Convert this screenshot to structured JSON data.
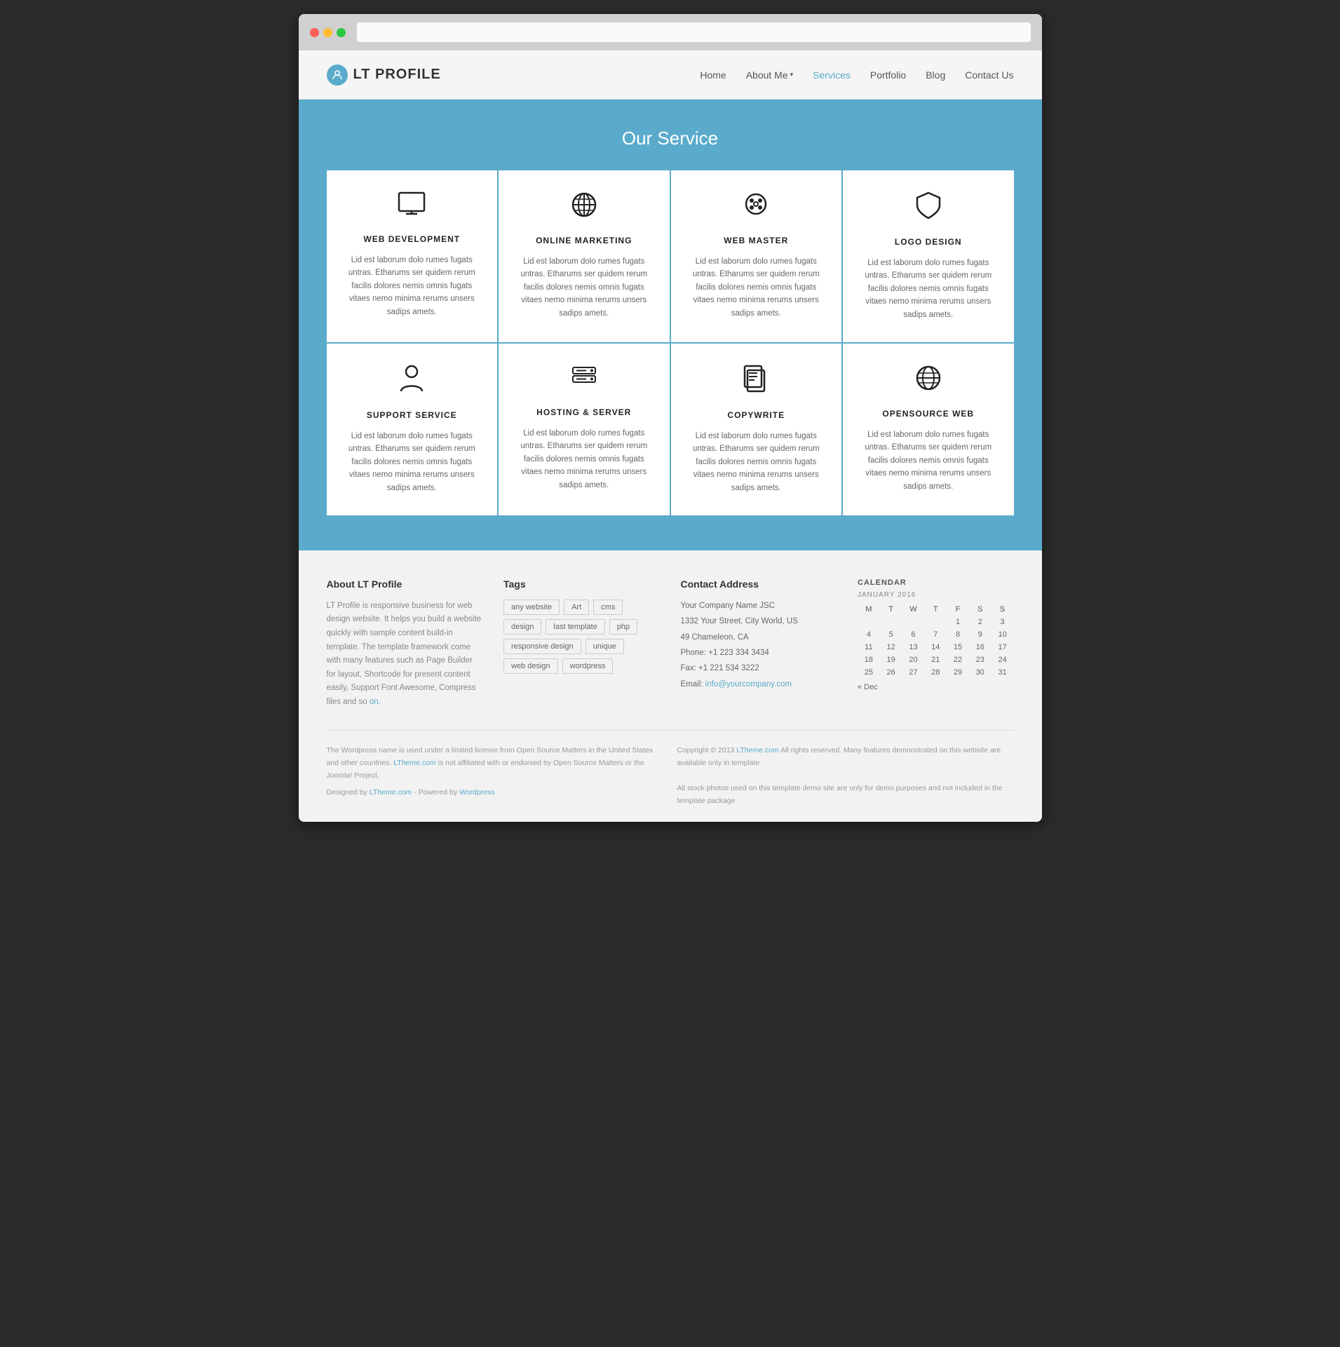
{
  "browser": {
    "dots": [
      "red",
      "yellow",
      "green"
    ]
  },
  "header": {
    "logo_text": "LT PROFILE",
    "nav_items": [
      {
        "label": "Home",
        "active": false
      },
      {
        "label": "About Me",
        "dropdown": true,
        "active": false
      },
      {
        "label": "Services",
        "active": true
      },
      {
        "label": "Portfolio",
        "active": false
      },
      {
        "label": "Blog",
        "active": false
      },
      {
        "label": "Contact Us",
        "active": false
      }
    ]
  },
  "services": {
    "section_title": "Our Service",
    "cards": [
      {
        "name": "WEB DEVELOPMENT",
        "icon": "🖥",
        "desc": "Lid est laborum dolo rumes fugats untras. Etharums ser quidem rerum facilis dolores nemis omnis fugats vitaes nemo minima rerums unsers sadips amets."
      },
      {
        "name": "ONLINE MARKETING",
        "icon": "⊕",
        "desc": "Lid est laborum dolo rumes fugats untras. Etharums ser quidem rerum facilis dolores nemis omnis fugats vitaes nemo minima rerums unsers sadips amets."
      },
      {
        "name": "WEB MASTER",
        "icon": "🎨",
        "desc": "Lid est laborum dolo rumes fugats untras. Etharums ser quidem rerum facilis dolores nemis omnis fugats vitaes nemo minima rerums unsers sadips amets."
      },
      {
        "name": "LOGO DESIGN",
        "icon": "🛡",
        "desc": "Lid est laborum dolo rumes fugats untras. Etharums ser quidem rerum facilis dolores nemis omnis fugats vitaes nemo minima rerums unsers sadips amets."
      },
      {
        "name": "SUPPORT SERVICE",
        "icon": "👤",
        "desc": "Lid est laborum dolo rumes fugats untras. Etharums ser quidem rerum facilis dolores nemis omnis fugats vitaes nemo minima rerums unsers sadips amets."
      },
      {
        "name": "HOSTING & SERVER",
        "icon": "≡",
        "desc": "Lid est laborum dolo rumes fugats untras. Etharums ser quidem rerum facilis dolores nemis omnis fugats vitaes nemo minima rerums unsers sadips amets."
      },
      {
        "name": "COPYWRITE",
        "icon": "📋",
        "desc": "Lid est laborum dolo rumes fugats untras. Etharums ser quidem rerum facilis dolores nemis omnis fugats vitaes nemo minima rerums unsers sadips amets."
      },
      {
        "name": "OPENSOURCE WEB",
        "icon": "🌐",
        "desc": "Lid est laborum dolo rumes fugats untras. Etharums ser quidem rerum facilis dolores nemis omnis fugats vitaes nemo minima rerums unsers sadips amets."
      }
    ]
  },
  "footer": {
    "about_title": "About LT Profile",
    "about_text": "LT Profile is responsive business for web design website. It helps you build a website quickly with sample content build-in template. The template framework come with many features such as Page Builder for layout, Shortcode for present content easily, Support Font Awesome, Compress files and so",
    "about_link_text": "on.",
    "tags_title": "Tags",
    "tags": [
      "any website",
      "Art",
      "cms",
      "design",
      "last template",
      "php",
      "responsive design",
      "unique",
      "web design",
      "wordpress"
    ],
    "contact_title": "Contact Address",
    "contact_company": "Your Company Name JSC",
    "contact_address1": "1332 Your Street, City World, US",
    "contact_address2": "49 Chameleon, CA",
    "contact_phone": "Phone: +1 223 334 3434",
    "contact_fax": "Fax: +1 221 534 3222",
    "contact_email_label": "Email:",
    "contact_email": "info@yourcompany.com",
    "calendar_title": "CALENDAR",
    "calendar_month": "JANUARY 2016",
    "calendar_days_header": [
      "M",
      "T",
      "W",
      "T",
      "F",
      "S",
      "S"
    ],
    "calendar_rows": [
      [
        "",
        "",
        "",
        "",
        "1",
        "2",
        "3"
      ],
      [
        "4",
        "5",
        "6",
        "7",
        "8",
        "9",
        "10"
      ],
      [
        "11",
        "12",
        "13",
        "14",
        "15",
        "16",
        "17"
      ],
      [
        "18",
        "19",
        "20",
        "21",
        "22",
        "23",
        "24"
      ],
      [
        "25",
        "26",
        "27",
        "28",
        "29",
        "30",
        "31"
      ]
    ],
    "calendar_nav": "« Dec",
    "bottom_left1": "The Wordpress name is used under a limited license from Open Source Matters in the United States and other countries.",
    "bottom_left1_link": "LTheme.com",
    "bottom_left2": "is not affiliated with or endorsed by Open Source Matters or the Joomla! Project.",
    "bottom_designer": "Designed by",
    "bottom_designer_link": "LTheme.com",
    "bottom_designer_sep": " - Powered by ",
    "bottom_designer_link2": "Wordpress",
    "bottom_right1": "Copyright © 2013",
    "bottom_right1_link": "LTheme.com",
    "bottom_right2": "All rights reserved. Many features demonstrated on this website are available only in template",
    "bottom_right3": "All stock photos used on this template demo site are only for demo purposes and not included in the template package"
  }
}
